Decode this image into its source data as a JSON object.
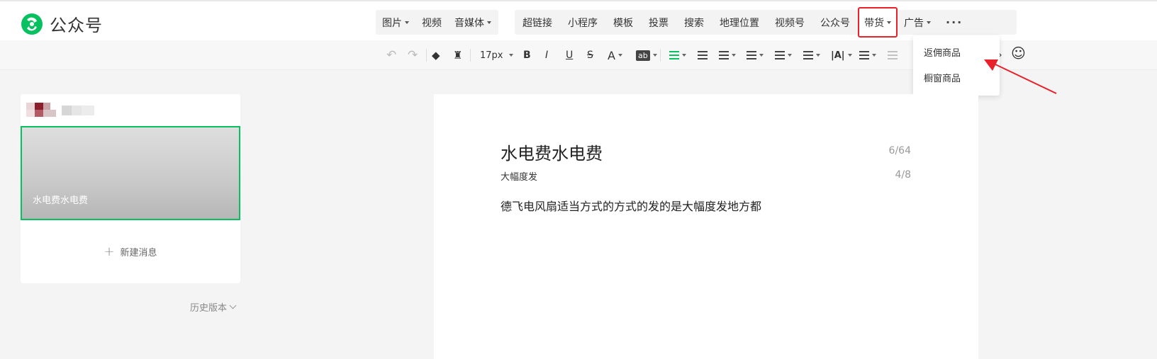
{
  "app": {
    "title": "公众号",
    "accent_color": "#07c160",
    "highlight_color": "#e8212b"
  },
  "insert_menu": {
    "group1": [
      {
        "label": "图片",
        "has_caret": true
      },
      {
        "label": "视频",
        "has_caret": false
      },
      {
        "label": "音媒体",
        "has_caret": true
      }
    ],
    "group2": [
      {
        "label": "超链接",
        "has_caret": false
      },
      {
        "label": "小程序",
        "has_caret": false
      },
      {
        "label": "模板",
        "has_caret": false
      },
      {
        "label": "投票",
        "has_caret": false
      },
      {
        "label": "搜索",
        "has_caret": false
      },
      {
        "label": "地理位置",
        "has_caret": false
      },
      {
        "label": "视频号",
        "has_caret": false
      },
      {
        "label": "公众号",
        "has_caret": false
      },
      {
        "label": "带货",
        "has_caret": true,
        "active": true
      },
      {
        "label": "广告",
        "has_caret": true
      }
    ],
    "more": "···"
  },
  "dropdown": {
    "items": [
      "返佣商品",
      "橱窗商品"
    ]
  },
  "format_toolbar": {
    "undo_icon": "undo-icon",
    "redo_icon": "redo-icon",
    "font_size": "17px",
    "bold": "B",
    "italic": "I",
    "underline": "U",
    "strike": "S",
    "font_color": "A",
    "bg_color": "ab",
    "letter_spacing": "|A|"
  },
  "sidebar": {
    "article_title": "水电费水电费",
    "new_message": "新建消息",
    "history": "历史版本"
  },
  "editor": {
    "title": "水电费水电费",
    "title_count": "6/64",
    "author": "大幅度发",
    "author_count": "4/8",
    "body": "德飞电风扇适当方式的方式的发的是大幅度发地方都"
  }
}
